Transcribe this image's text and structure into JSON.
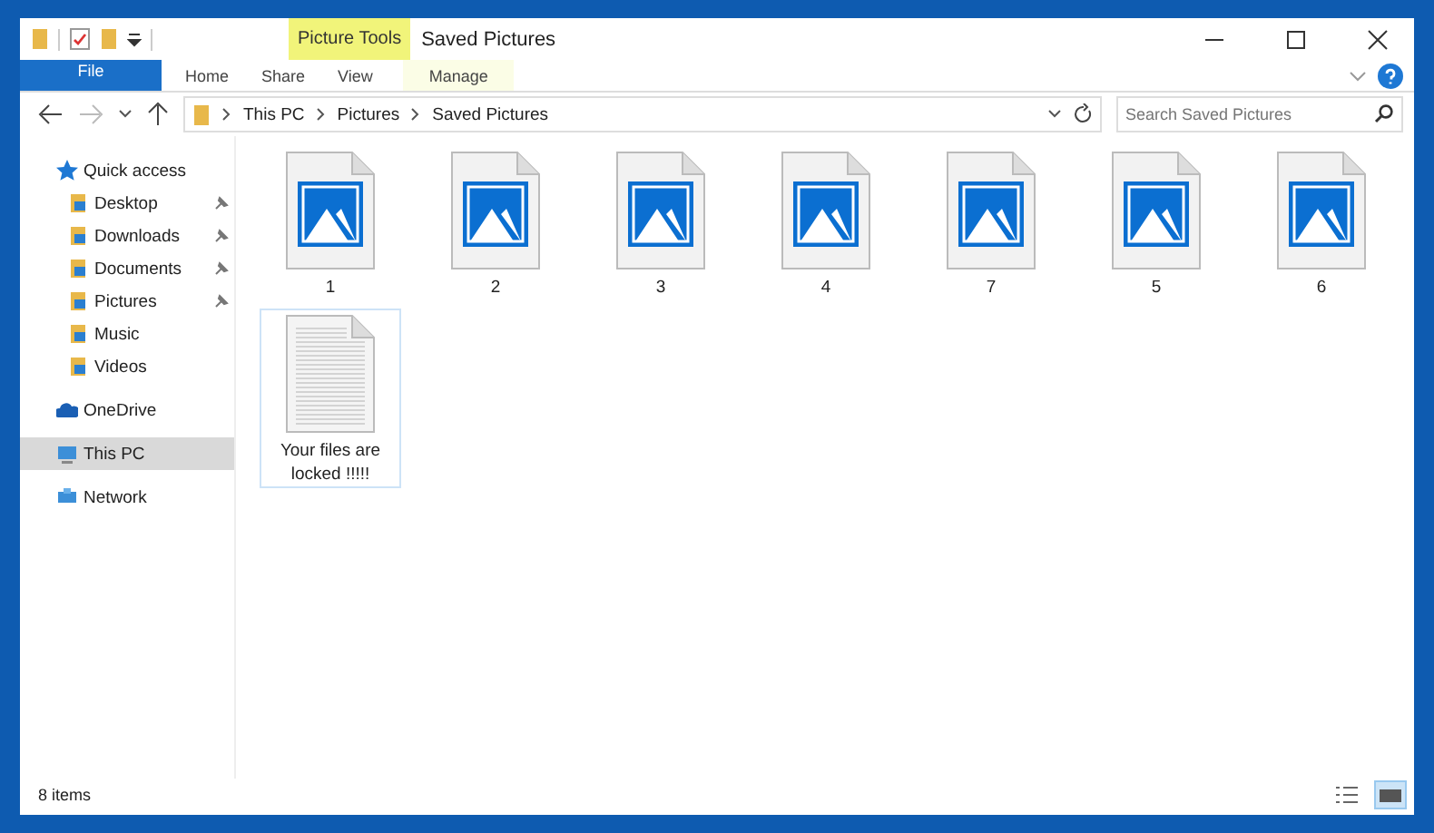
{
  "window": {
    "title": "Saved Pictures",
    "context_tab": "Picture Tools"
  },
  "ribbon_tabs": [
    {
      "label": "File",
      "kind": "file",
      "selected": false
    },
    {
      "label": "Home",
      "kind": "tab",
      "selected": false
    },
    {
      "label": "Share",
      "kind": "tab",
      "selected": false
    },
    {
      "label": "View",
      "kind": "tab",
      "selected": false
    },
    {
      "label": "Manage",
      "kind": "context",
      "selected": false
    }
  ],
  "breadcrumb": [
    "This PC",
    "Pictures",
    "Saved Pictures"
  ],
  "search": {
    "placeholder": "Search Saved Pictures"
  },
  "sidebar": [
    {
      "label": "Quick access",
      "kind": "star",
      "selected": false,
      "children": [
        {
          "label": "Desktop",
          "kind": "folder",
          "pinned": true,
          "selected": false
        },
        {
          "label": "Downloads",
          "kind": "folder",
          "pinned": true,
          "selected": false
        },
        {
          "label": "Documents",
          "kind": "folder",
          "pinned": true,
          "selected": false
        },
        {
          "label": "Pictures",
          "kind": "folder",
          "pinned": true,
          "selected": false
        },
        {
          "label": "Music",
          "kind": "folder",
          "pinned": false,
          "selected": false
        },
        {
          "label": "Videos",
          "kind": "folder",
          "pinned": false,
          "selected": false
        }
      ]
    },
    {
      "label": "OneDrive",
      "kind": "cloud",
      "selected": false
    },
    {
      "label": "This PC",
      "kind": "pc",
      "selected": true
    },
    {
      "label": "Network",
      "kind": "network",
      "selected": false
    }
  ],
  "files": [
    {
      "name": "1",
      "kind": "image",
      "selected": false
    },
    {
      "name": "2",
      "kind": "image",
      "selected": false
    },
    {
      "name": "3",
      "kind": "image",
      "selected": false
    },
    {
      "name": "4",
      "kind": "image",
      "selected": false
    },
    {
      "name": "7",
      "kind": "image",
      "selected": false
    },
    {
      "name": "5",
      "kind": "image",
      "selected": false
    },
    {
      "name": "6",
      "kind": "image",
      "selected": false
    },
    {
      "name": "Your files are locked !!!!!",
      "kind": "text",
      "selected": true
    }
  ],
  "status_bar": {
    "count": "8 items"
  }
}
